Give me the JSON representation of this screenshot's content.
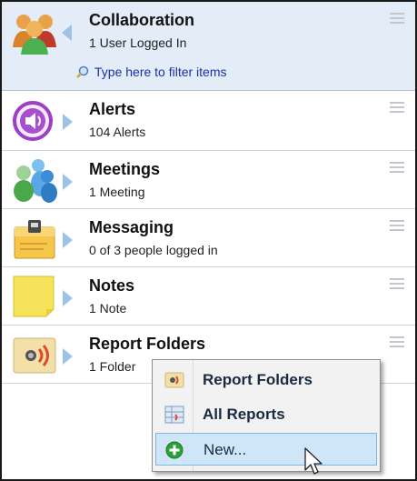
{
  "header": {
    "title": "Collaboration",
    "subtitle": "1 User Logged In",
    "filter_placeholder": "Type here to filter items"
  },
  "items": [
    {
      "title": "Alerts",
      "subtitle": "104 Alerts",
      "icon": "alerts-speaker-icon"
    },
    {
      "title": "Meetings",
      "subtitle": "1 Meeting",
      "icon": "meetings-people-icon"
    },
    {
      "title": "Messaging",
      "subtitle": "0 of 3 people logged in",
      "icon": "messaging-clipboard-icon"
    },
    {
      "title": "Notes",
      "subtitle": "1 Note",
      "icon": "sticky-note-icon"
    },
    {
      "title": "Report Folders",
      "subtitle": "1 Folder",
      "icon": "report-folder-icon"
    }
  ],
  "context_menu": {
    "items": [
      {
        "label": "Report Folders",
        "icon": "report-folder-icon"
      },
      {
        "label": "All Reports",
        "icon": "all-reports-icon"
      },
      {
        "label": "New...",
        "icon": "add-green-icon",
        "selected": true
      }
    ]
  },
  "colors": {
    "header_bg": "#e4ecf7",
    "link": "#1b2fa8",
    "menu_selected": "#cfe6f8",
    "arrow": "#9ec2e6"
  }
}
